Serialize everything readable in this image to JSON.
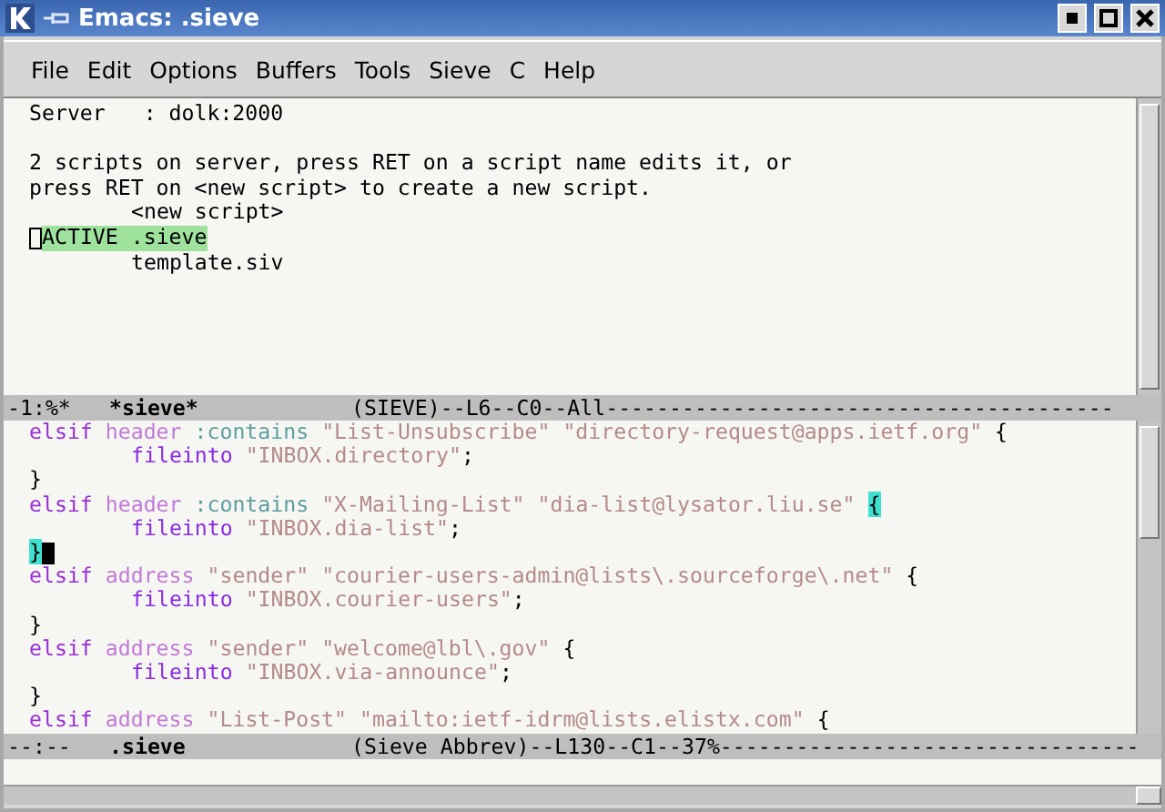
{
  "window": {
    "title": "Emacs: .sieve"
  },
  "menu": [
    "File",
    "Edit",
    "Options",
    "Buffers",
    "Tools",
    "Sieve",
    "C",
    "Help"
  ],
  "top_pane": {
    "header": "Server   : dolk:2000",
    "message": [
      "2 scripts on server, press RET on a script name edits it, or",
      "press RET on <new script> to create a new script."
    ],
    "scripts": [
      {
        "text": "<new script>",
        "selected": false
      },
      {
        "status": "ACTIVE",
        "text": ".sieve",
        "selected": true
      },
      {
        "text": "template.siv",
        "selected": false
      }
    ]
  },
  "top_mode_line": {
    "status": "-1:%*",
    "buffer": "*sieve*",
    "position": "(SIEVE)--L6--C0--All----------------------------------------"
  },
  "bottom_pane": {
    "lines": [
      {
        "indented": false,
        "cursor": false,
        "tokens": [
          {
            "kind": "keyword",
            "text": "elsif"
          },
          {
            "kind": "test",
            "text": "header"
          },
          {
            "kind": "tag",
            "text": ":contains"
          },
          {
            "kind": "string",
            "text": "\"List-Unsubscribe\""
          },
          {
            "kind": "string",
            "text": "\"directory-request@apps.ietf.org\""
          },
          {
            "kind": "brace",
            "text": "{"
          }
        ]
      },
      {
        "indented": true,
        "cursor": false,
        "tokens": [
          {
            "kind": "action",
            "text": "fileinto"
          },
          {
            "kind": "string",
            "text": "\"INBOX.directory\""
          },
          {
            "kind": "punct",
            "text": ";"
          }
        ]
      },
      {
        "indented": false,
        "cursor": false,
        "tokens": [
          {
            "kind": "brace",
            "text": "}"
          }
        ]
      },
      {
        "indented": false,
        "cursor": false,
        "tokens": [
          {
            "kind": "keyword",
            "text": "elsif"
          },
          {
            "kind": "test",
            "text": "header"
          },
          {
            "kind": "tag",
            "text": ":contains"
          },
          {
            "kind": "string",
            "text": "\"X-Mailing-List\""
          },
          {
            "kind": "string",
            "text": "\"dia-list@lysator.liu.se\""
          },
          {
            "kind": "brace-match",
            "text": "{"
          }
        ]
      },
      {
        "indented": true,
        "cursor": false,
        "tokens": [
          {
            "kind": "action",
            "text": "fileinto"
          },
          {
            "kind": "string",
            "text": "\"INBOX.dia-list\""
          },
          {
            "kind": "punct",
            "text": ";"
          }
        ]
      },
      {
        "indented": false,
        "cursor": true,
        "tokens": [
          {
            "kind": "brace-match",
            "text": "}"
          }
        ]
      },
      {
        "indented": false,
        "cursor": false,
        "tokens": [
          {
            "kind": "keyword",
            "text": "elsif"
          },
          {
            "kind": "test",
            "text": "address"
          },
          {
            "kind": "string",
            "text": "\"sender\""
          },
          {
            "kind": "string",
            "text": "\"courier-users-admin@lists\\.sourceforge\\.net\""
          },
          {
            "kind": "brace",
            "text": "{"
          }
        ]
      },
      {
        "indented": true,
        "cursor": false,
        "tokens": [
          {
            "kind": "action",
            "text": "fileinto"
          },
          {
            "kind": "string",
            "text": "\"INBOX.courier-users\""
          },
          {
            "kind": "punct",
            "text": ";"
          }
        ]
      },
      {
        "indented": false,
        "cursor": false,
        "tokens": [
          {
            "kind": "brace",
            "text": "}"
          }
        ]
      },
      {
        "indented": false,
        "cursor": false,
        "tokens": [
          {
            "kind": "keyword",
            "text": "elsif"
          },
          {
            "kind": "test",
            "text": "address"
          },
          {
            "kind": "string",
            "text": "\"sender\""
          },
          {
            "kind": "string",
            "text": "\"welcome@lbl\\.gov\""
          },
          {
            "kind": "brace",
            "text": "{"
          }
        ]
      },
      {
        "indented": true,
        "cursor": false,
        "tokens": [
          {
            "kind": "action",
            "text": "fileinto"
          },
          {
            "kind": "string",
            "text": "\"INBOX.via-announce\""
          },
          {
            "kind": "punct",
            "text": ";"
          }
        ]
      },
      {
        "indented": false,
        "cursor": false,
        "tokens": [
          {
            "kind": "brace",
            "text": "}"
          }
        ]
      },
      {
        "indented": false,
        "cursor": false,
        "tokens": [
          {
            "kind": "keyword",
            "text": "elsif"
          },
          {
            "kind": "test",
            "text": "address"
          },
          {
            "kind": "string",
            "text": "\"List-Post\""
          },
          {
            "kind": "string",
            "text": "\"mailto:ietf-idrm@lists.elistx.com\""
          },
          {
            "kind": "brace",
            "text": "{"
          }
        ]
      }
    ]
  },
  "bottom_mode_line": {
    "status": "--:--",
    "buffer": ".sieve",
    "position": "(Sieve Abbrev)--L130--C1--37%---------------------------------"
  }
}
